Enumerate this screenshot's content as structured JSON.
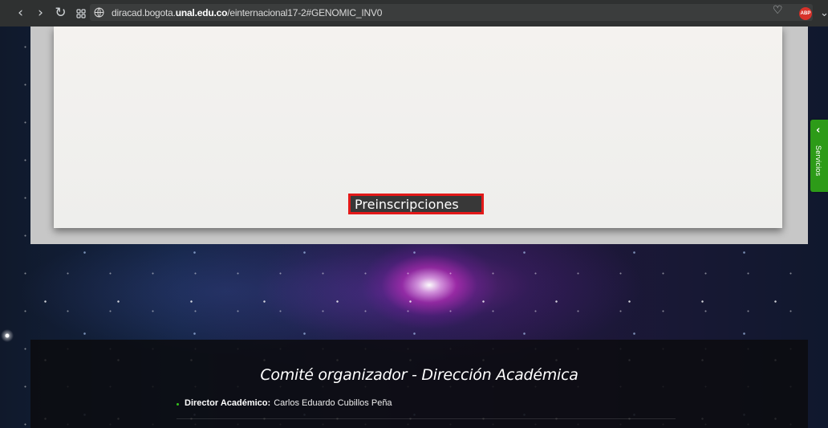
{
  "browser": {
    "url_prefix": "diracad.bogota.",
    "url_domain": "unal.edu.co",
    "url_suffix": "/einternacional17-2#GENOMIC_INV0",
    "back_icon": "chevron-left-icon",
    "forward_icon": "chevron-right-icon",
    "reload_icon": "reload-icon",
    "grid_icon": "grid-icon",
    "globe_icon": "globe-icon",
    "heart_icon": "heart-icon",
    "adblock_label": "ABP"
  },
  "main": {
    "preinscription_button": "Preinscripciones"
  },
  "sidebar": {
    "services_label": "Servicios",
    "chevron": "‹"
  },
  "committee": {
    "title": "Comité organizador - Dirección Académica",
    "director_label": "Director Académico:",
    "director_name": "Carlos Eduardo Cubillos Peña"
  },
  "colors": {
    "button_border": "#e31919",
    "services_green": "#2d9b18",
    "bullet_green": "#36c21d"
  }
}
